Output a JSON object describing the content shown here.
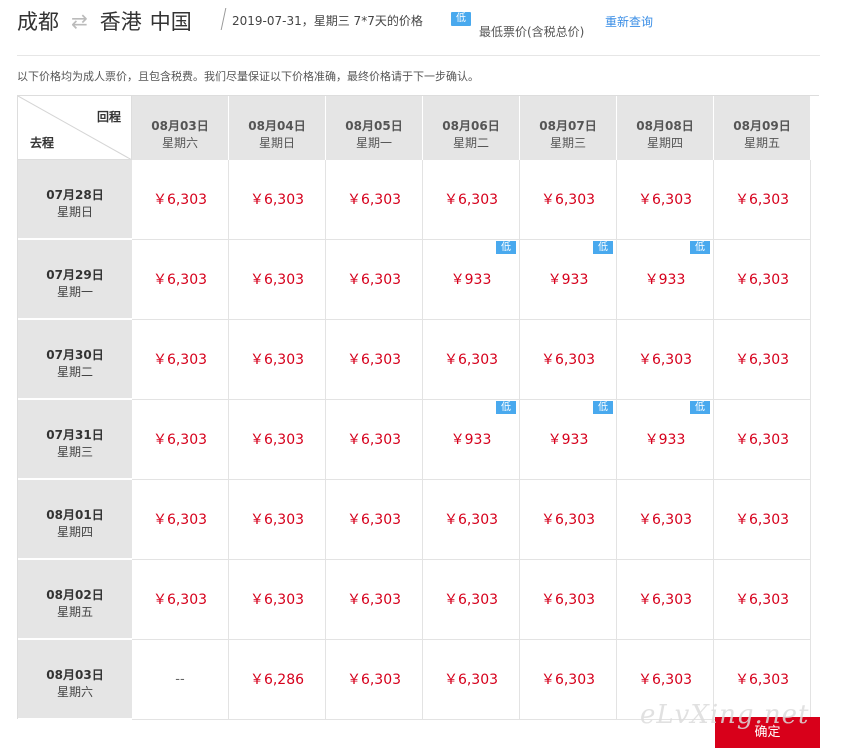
{
  "header": {
    "origin": "成都",
    "route_arrow": "⇄",
    "destination": "香港",
    "country": "中国",
    "date_info": "2019-07-31，星期三   7*7天的价格",
    "low_badge": "低",
    "lowest_label": "最低票价(含税总价)",
    "requery": "重新查询"
  },
  "notice": "以下价格均为成人票价，且包含税费。我们尽量保证以下价格准确，最终价格请于下一步确认。",
  "grid": {
    "corner_return": "回程",
    "corner_depart": "去程",
    "columns": [
      {
        "date": "08月03日",
        "weekday": "星期六"
      },
      {
        "date": "08月04日",
        "weekday": "星期日"
      },
      {
        "date": "08月05日",
        "weekday": "星期一"
      },
      {
        "date": "08月06日",
        "weekday": "星期二"
      },
      {
        "date": "08月07日",
        "weekday": "星期三"
      },
      {
        "date": "08月08日",
        "weekday": "星期四"
      },
      {
        "date": "08月09日",
        "weekday": "星期五"
      }
    ],
    "rows": [
      {
        "date": "07月28日",
        "weekday": "星期日",
        "cells": [
          {
            "price": "￥6,303",
            "low": false
          },
          {
            "price": "￥6,303",
            "low": false
          },
          {
            "price": "￥6,303",
            "low": false
          },
          {
            "price": "￥6,303",
            "low": false
          },
          {
            "price": "￥6,303",
            "low": false
          },
          {
            "price": "￥6,303",
            "low": false
          },
          {
            "price": "￥6,303",
            "low": false
          }
        ]
      },
      {
        "date": "07月29日",
        "weekday": "星期一",
        "cells": [
          {
            "price": "￥6,303",
            "low": false
          },
          {
            "price": "￥6,303",
            "low": false
          },
          {
            "price": "￥6,303",
            "low": false
          },
          {
            "price": "￥933",
            "low": true
          },
          {
            "price": "￥933",
            "low": true
          },
          {
            "price": "￥933",
            "low": true
          },
          {
            "price": "￥6,303",
            "low": false
          }
        ]
      },
      {
        "date": "07月30日",
        "weekday": "星期二",
        "cells": [
          {
            "price": "￥6,303",
            "low": false
          },
          {
            "price": "￥6,303",
            "low": false
          },
          {
            "price": "￥6,303",
            "low": false
          },
          {
            "price": "￥6,303",
            "low": false
          },
          {
            "price": "￥6,303",
            "low": false
          },
          {
            "price": "￥6,303",
            "low": false
          },
          {
            "price": "￥6,303",
            "low": false
          }
        ]
      },
      {
        "date": "07月31日",
        "weekday": "星期三",
        "cells": [
          {
            "price": "￥6,303",
            "low": false
          },
          {
            "price": "￥6,303",
            "low": false
          },
          {
            "price": "￥6,303",
            "low": false
          },
          {
            "price": "￥933",
            "low": true
          },
          {
            "price": "￥933",
            "low": true
          },
          {
            "price": "￥933",
            "low": true
          },
          {
            "price": "￥6,303",
            "low": false
          }
        ]
      },
      {
        "date": "08月01日",
        "weekday": "星期四",
        "cells": [
          {
            "price": "￥6,303",
            "low": false
          },
          {
            "price": "￥6,303",
            "low": false
          },
          {
            "price": "￥6,303",
            "low": false
          },
          {
            "price": "￥6,303",
            "low": false
          },
          {
            "price": "￥6,303",
            "low": false
          },
          {
            "price": "￥6,303",
            "low": false
          },
          {
            "price": "￥6,303",
            "low": false
          }
        ]
      },
      {
        "date": "08月02日",
        "weekday": "星期五",
        "cells": [
          {
            "price": "￥6,303",
            "low": false
          },
          {
            "price": "￥6,303",
            "low": false
          },
          {
            "price": "￥6,303",
            "low": false
          },
          {
            "price": "￥6,303",
            "low": false
          },
          {
            "price": "￥6,303",
            "low": false
          },
          {
            "price": "￥6,303",
            "low": false
          },
          {
            "price": "￥6,303",
            "low": false
          }
        ]
      },
      {
        "date": "08月03日",
        "weekday": "星期六",
        "cells": [
          {
            "price": "--",
            "low": false
          },
          {
            "price": "￥6,286",
            "low": false
          },
          {
            "price": "￥6,303",
            "low": false
          },
          {
            "price": "￥6,303",
            "low": false
          },
          {
            "price": "￥6,303",
            "low": false
          },
          {
            "price": "￥6,303",
            "low": false
          },
          {
            "price": "￥6,303",
            "low": false
          }
        ]
      }
    ]
  },
  "confirm_label": "确定",
  "watermark": "eLvXing.net",
  "colors": {
    "price": "#d6001c",
    "badge": "#49a9ee",
    "header_bg": "#e5e5e5",
    "confirm": "#d8001a",
    "link": "#3a8ee6"
  }
}
